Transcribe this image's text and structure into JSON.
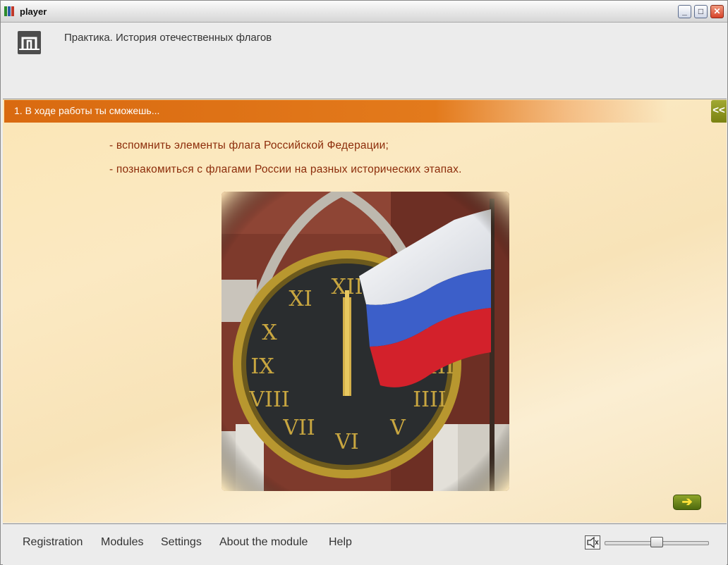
{
  "window": {
    "title": "player"
  },
  "header": {
    "lesson_title": "Практика. История отечественных флагов"
  },
  "section": {
    "title": "1. В ходе работы ты сможешь...",
    "collapse_label": "<<"
  },
  "content": {
    "bullets": [
      "- вспомнить элементы флага Российской Федерации;",
      "- познакомиться с флагами России на разных исторических этапах."
    ],
    "next_label": "➔"
  },
  "footer": {
    "menu": [
      "Registration",
      "Modules",
      "Settings",
      "About the module",
      "Help"
    ],
    "volume": 0.5
  },
  "colors": {
    "accent_orange": "#d96a10",
    "text_brown": "#8c2c0a",
    "nav_green": "#7a8212"
  }
}
